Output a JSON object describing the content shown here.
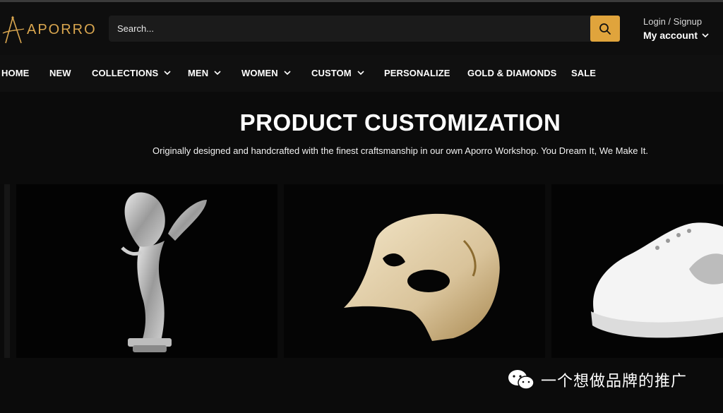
{
  "header": {
    "logo_text": "APORRO",
    "search_placeholder": "Search...",
    "login_label": "Login / Signup",
    "account_label": "My account"
  },
  "nav": {
    "items": [
      {
        "label": "HOME"
      },
      {
        "label": "NEW"
      },
      {
        "label": "COLLECTIONS"
      },
      {
        "label": "MEN"
      },
      {
        "label": "WOMEN"
      },
      {
        "label": "CUSTOM"
      },
      {
        "label": "PERSONALIZE"
      },
      {
        "label": "GOLD & DIAMONDS"
      },
      {
        "label": "SALE"
      }
    ]
  },
  "hero": {
    "title": "PRODUCT CUSTOMIZATION",
    "subtitle": "Originally designed and handcrafted with the finest craftsmanship in our own Aporro Workshop. You Dream It, We Make It."
  },
  "carousel": {
    "cards": [
      {
        "icon": "hood-ornament-image"
      },
      {
        "icon": "diamond-mask-image"
      },
      {
        "icon": "sneaker-image"
      }
    ]
  },
  "watermark": {
    "text": "一个想做品牌的推广",
    "icon": "wechat-icon"
  },
  "colors": {
    "accent": "#e0a43c",
    "background": "#0b0b0b"
  }
}
